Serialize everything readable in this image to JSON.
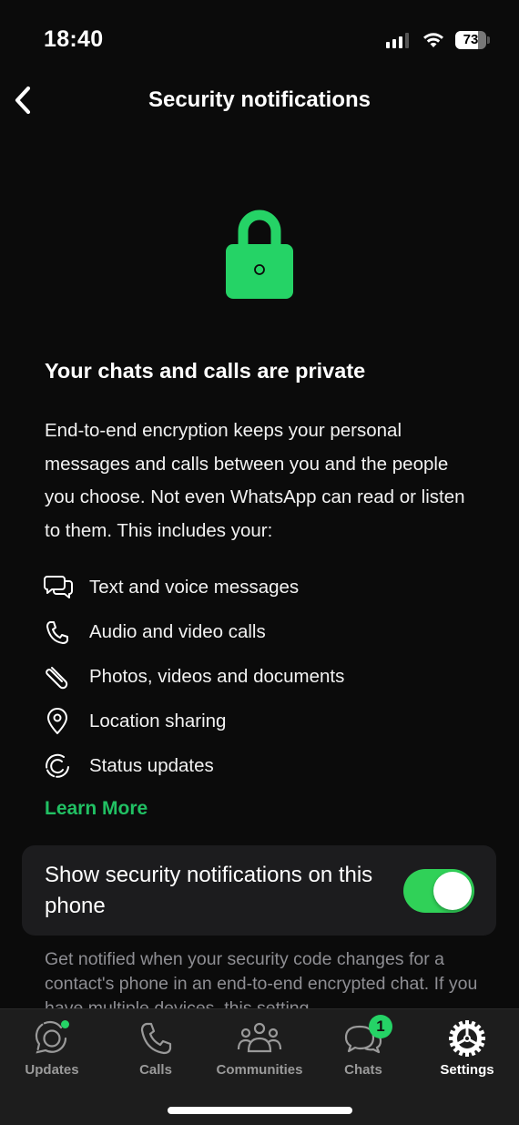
{
  "status_bar": {
    "time": "18:40",
    "battery_percent": 73,
    "battery_label": "73",
    "signal_bars_active": 3,
    "signal_bars_total": 4
  },
  "nav": {
    "back_icon": "chevron-left-icon",
    "title": "Security notifications"
  },
  "hero": {
    "icon": "lock-icon",
    "accent_color": "#25d366"
  },
  "content": {
    "heading": "Your chats and calls are private",
    "description": "End-to-end encryption keeps your personal messages and calls between you and the people you choose. Not even WhatsApp can read or listen to them. This includes your:",
    "features": [
      {
        "icon": "chat-bubbles-icon",
        "label": "Text and voice messages"
      },
      {
        "icon": "phone-icon",
        "label": "Audio and video calls"
      },
      {
        "icon": "paperclip-icon",
        "label": "Photos, videos and documents"
      },
      {
        "icon": "location-pin-icon",
        "label": "Location sharing"
      },
      {
        "icon": "status-icon",
        "label": "Status updates"
      }
    ],
    "learn_more": "Learn More",
    "link_color": "#21c063"
  },
  "setting": {
    "label": "Show security notifications on this phone",
    "enabled": true,
    "toggle_color": "#30d158",
    "footnote": "Get notified when your security code changes for a contact's phone in an end-to-end encrypted chat. If you have multiple devices, this setting"
  },
  "tab_bar": {
    "tabs": [
      {
        "icon": "updates-icon",
        "label": "Updates",
        "active": false,
        "has_dot": true
      },
      {
        "icon": "phone-icon",
        "label": "Calls",
        "active": false
      },
      {
        "icon": "communities-icon",
        "label": "Communities",
        "active": false
      },
      {
        "icon": "chats-icon",
        "label": "Chats",
        "active": false,
        "badge": "1"
      },
      {
        "icon": "settings-gear-icon",
        "label": "Settings",
        "active": true
      }
    ]
  }
}
